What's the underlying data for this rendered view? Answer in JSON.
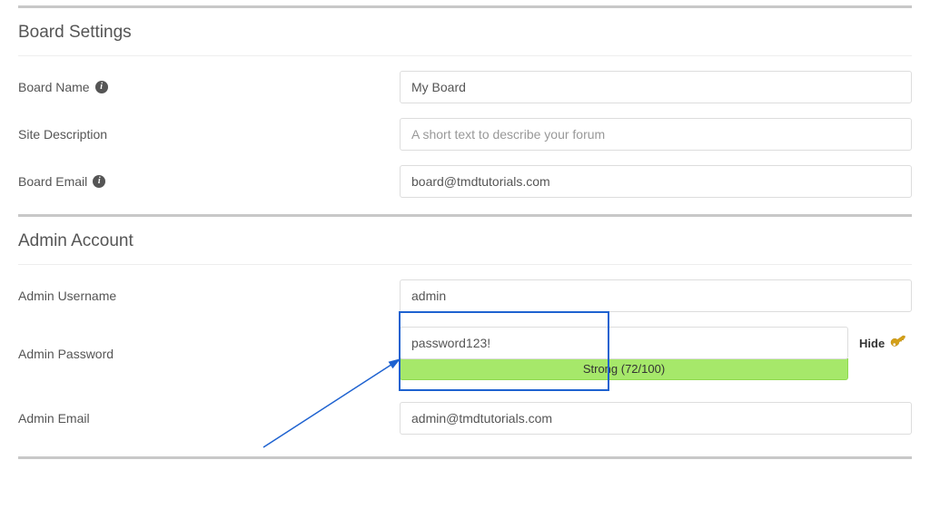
{
  "sections": {
    "board": {
      "title": "Board Settings",
      "board_name": {
        "label": "Board Name",
        "value": "My Board"
      },
      "site_desc": {
        "label": "Site Description",
        "placeholder": "A short text to describe your forum"
      },
      "board_email": {
        "label": "Board Email",
        "value": "board@tmdtutorials.com"
      }
    },
    "admin": {
      "title": "Admin Account",
      "username": {
        "label": "Admin Username",
        "value": "admin"
      },
      "password": {
        "label": "Admin Password",
        "value": "password123!",
        "toggle": "Hide",
        "strength": "Strong (72/100)"
      },
      "email": {
        "label": "Admin Email",
        "value": "admin@tmdtutorials.com"
      }
    }
  }
}
